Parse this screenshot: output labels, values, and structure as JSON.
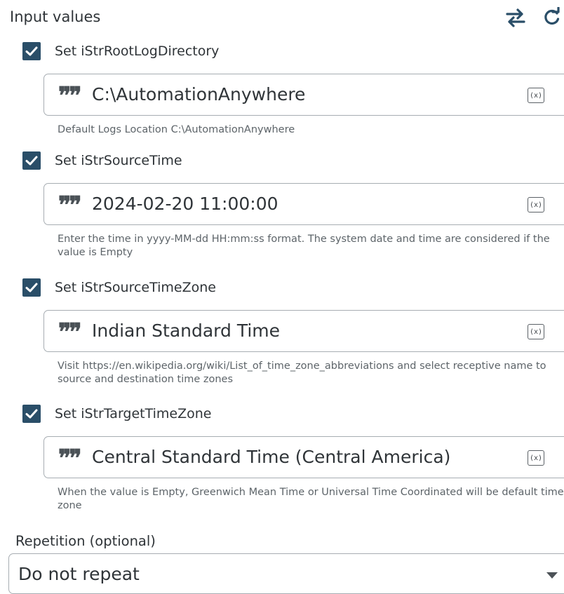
{
  "header": {
    "title": "Input values",
    "icons": [
      "swap-icon",
      "refresh-icon"
    ]
  },
  "params": [
    {
      "checked": true,
      "label": "Set iStrRootLogDirectory",
      "value": "C:\\AutomationAnywhere",
      "help": "Default Logs Location C:\\AutomationAnywhere"
    },
    {
      "checked": true,
      "label": "Set iStrSourceTime",
      "value": "2024-02-20 11:00:00",
      "help": "Enter the time in yyyy-MM-dd HH:mm:ss format. The system date and time are considered if the value is Empty"
    },
    {
      "checked": true,
      "label": "Set iStrSourceTimeZone",
      "value": "Indian Standard Time",
      "help": "Visit https://en.wikipedia.org/wiki/List_of_time_zone_abbreviations and select receptive name to source and destination time zones"
    },
    {
      "checked": true,
      "label": "Set iStrTargetTimeZone",
      "value": "Central Standard Time (Central America)",
      "help": "When the value is Empty, Greenwich Mean Time or Universal Time Coordinated will be default time zone"
    }
  ],
  "variable_icon_text": "(x)",
  "repetition": {
    "label": "Repetition (optional)",
    "selected": "Do not repeat"
  },
  "colors": {
    "checkbox": "#2a4e68",
    "header_icon": "#2a4e68"
  }
}
